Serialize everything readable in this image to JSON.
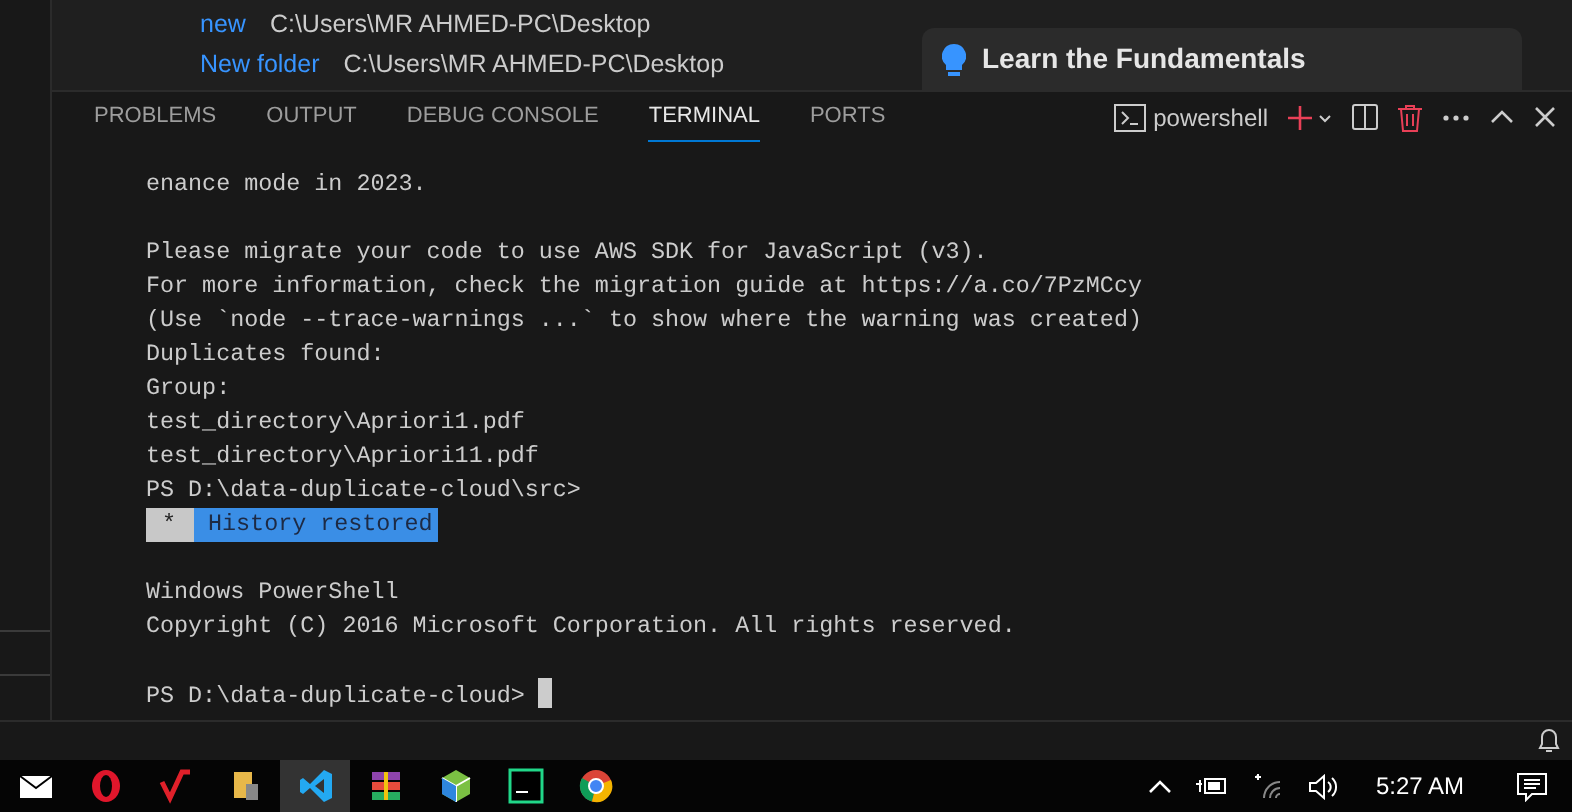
{
  "explorer_rows": [
    {
      "name": "new",
      "path": "C:\\Users\\MR AHMED-PC\\Desktop"
    },
    {
      "name": "New folder",
      "path": "C:\\Users\\MR AHMED-PC\\Desktop"
    }
  ],
  "walkthrough_card": {
    "title": "Learn the Fundamentals"
  },
  "panel": {
    "tabs": [
      {
        "label": "PROBLEMS",
        "selected": false
      },
      {
        "label": "OUTPUT",
        "selected": false
      },
      {
        "label": "DEBUG CONSOLE",
        "selected": false
      },
      {
        "label": "TERMINAL",
        "selected": true
      },
      {
        "label": "PORTS",
        "selected": false
      }
    ],
    "terminal_profile": "powershell"
  },
  "terminal_lines": [
    {
      "kind": "text",
      "text": "enance mode in 2023."
    },
    {
      "kind": "blank"
    },
    {
      "kind": "text",
      "text": "Please migrate your code to use AWS SDK for JavaScript (v3)."
    },
    {
      "kind": "text",
      "text": "For more information, check the migration guide at https://a.co/7PzMCcy"
    },
    {
      "kind": "text",
      "text": "(Use `node --trace-warnings ...` to show where the warning was created)"
    },
    {
      "kind": "text",
      "text": "Duplicates found:"
    },
    {
      "kind": "text",
      "text": "Group:"
    },
    {
      "kind": "text",
      "text": "test_directory\\Apriori1.pdf"
    },
    {
      "kind": "text",
      "text": "test_directory\\Apriori11.pdf"
    },
    {
      "kind": "text",
      "text": "PS D:\\data-duplicate-cloud\\src>"
    },
    {
      "kind": "badge",
      "mark": "*",
      "text": "History restored"
    },
    {
      "kind": "blank"
    },
    {
      "kind": "text",
      "text": "Windows PowerShell"
    },
    {
      "kind": "text",
      "text": "Copyright (C) 2016 Microsoft Corporation. All rights reserved."
    },
    {
      "kind": "blank"
    },
    {
      "kind": "prompt",
      "text": "PS D:\\data-duplicate-cloud>"
    }
  ],
  "taskbar": {
    "apps": [
      {
        "kind": "mail",
        "selected": false
      },
      {
        "kind": "opera",
        "selected": false
      },
      {
        "kind": "vee",
        "selected": false
      },
      {
        "kind": "archive",
        "selected": false
      },
      {
        "kind": "vscode",
        "selected": true
      },
      {
        "kind": "winrar",
        "selected": false
      },
      {
        "kind": "cube",
        "selected": false
      },
      {
        "kind": "pycharm",
        "selected": false
      },
      {
        "kind": "chrome",
        "selected": false
      }
    ],
    "clock": "5:27 AM"
  }
}
